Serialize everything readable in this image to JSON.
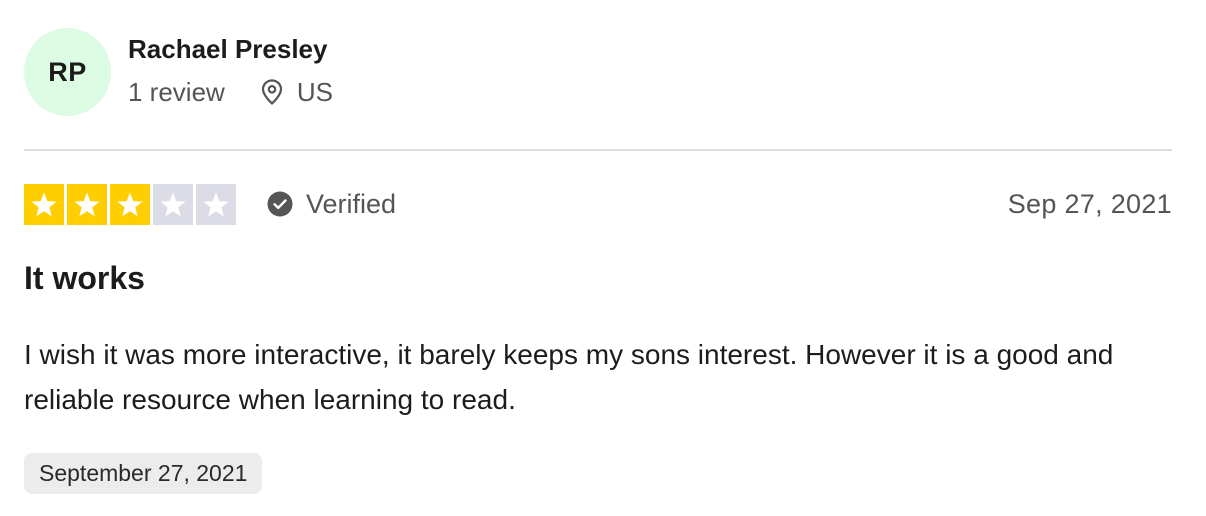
{
  "reviewer": {
    "initials": "RP",
    "name": "Rachael Presley",
    "review_count": "1 review",
    "location": "US",
    "avatar_color": "#dcfce4"
  },
  "rating": {
    "stars": 3,
    "max_stars": 5,
    "filled_color": "#ffce00",
    "empty_color": "#dcdce6"
  },
  "verified": {
    "label": "Verified",
    "icon": "check-circle-icon"
  },
  "review": {
    "date": "Sep 27, 2021",
    "title": "It works",
    "body": "I wish it was more interactive, it barely keeps my sons interest. However it is a good and reliable resource when learning to read.",
    "experience_date": "September 27, 2021"
  }
}
